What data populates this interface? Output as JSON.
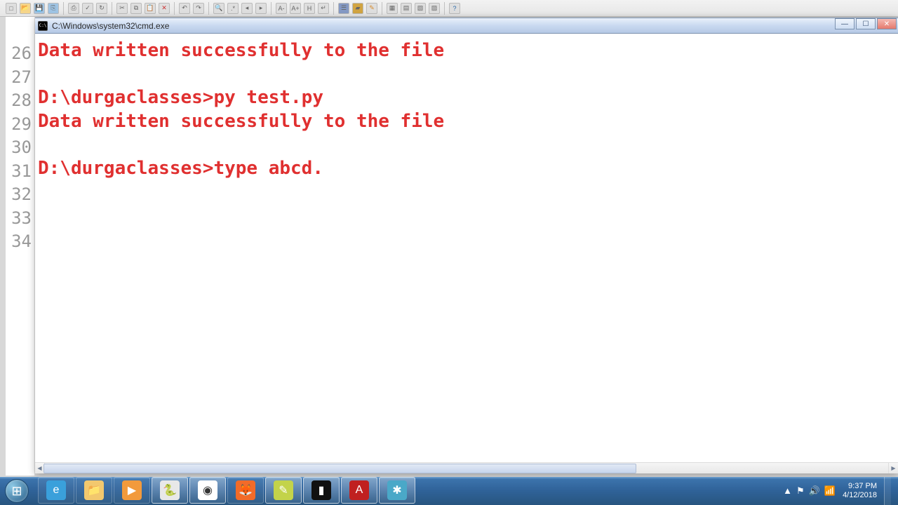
{
  "editor_toolbar": {
    "icons": [
      "new",
      "open",
      "save",
      "save-all",
      "copy-path",
      "print",
      "spellcheck",
      "refresh",
      "cut",
      "copy",
      "paste",
      "delete",
      "undo",
      "redo",
      "find",
      "find-reg",
      "prev",
      "next",
      "font-dec",
      "font-inc",
      "h1",
      "wrap",
      "panel",
      "highlight",
      "col",
      "row",
      "grid",
      "grid2",
      "help"
    ]
  },
  "gutter": {
    "start": 26,
    "lines": [
      26,
      27,
      28,
      29,
      30,
      31,
      32,
      33,
      34
    ]
  },
  "window": {
    "title": "C:\\Windows\\system32\\cmd.exe"
  },
  "terminal": {
    "lines": [
      "Data written successfully to the file",
      "",
      "D:\\durgaclasses>py test.py",
      "Data written successfully to the file",
      "",
      "D:\\durgaclasses>type abcd."
    ]
  },
  "taskbar": {
    "items": [
      {
        "name": "internet-explorer",
        "glyph": "e",
        "bg": "#3aa0db",
        "active": false
      },
      {
        "name": "file-explorer",
        "glyph": "📁",
        "bg": "#f2c86e",
        "active": false
      },
      {
        "name": "media-player",
        "glyph": "▶",
        "bg": "#f29a3c",
        "active": false
      },
      {
        "name": "python-idle",
        "glyph": "🐍",
        "bg": "#e8e8e8",
        "active": true
      },
      {
        "name": "chrome",
        "glyph": "◉",
        "bg": "#ffffff",
        "active": true
      },
      {
        "name": "firefox",
        "glyph": "🦊",
        "bg": "#f26b29",
        "active": false
      },
      {
        "name": "editplus",
        "glyph": "✎",
        "bg": "#c3d34a",
        "active": true
      },
      {
        "name": "cmd",
        "glyph": "▮",
        "bg": "#111111",
        "active": true
      },
      {
        "name": "adobe-reader",
        "glyph": "A",
        "bg": "#c02020",
        "active": true
      },
      {
        "name": "utility",
        "glyph": "✱",
        "bg": "#4aa8c8",
        "active": true
      }
    ]
  },
  "tray": {
    "up_arrow": "▲",
    "flag": "⚑",
    "volume": "🔊",
    "network": "📶",
    "time": "9:37 PM",
    "date": "4/12/2018"
  }
}
